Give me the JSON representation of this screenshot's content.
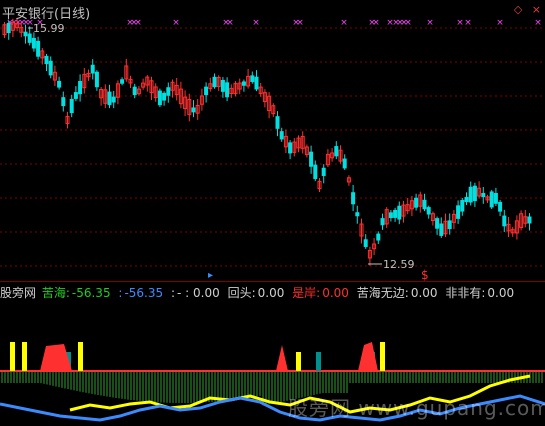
{
  "title": "平安银行(日线)",
  "price_labels": {
    "high": "15.99",
    "low": "12.59"
  },
  "signal_marker": "$",
  "indicator": {
    "name": "股旁网",
    "items": [
      {
        "label": "苦海:",
        "value": "-56.35",
        "color": "#22cc22"
      },
      {
        "label": ":",
        "value": "-56.35",
        "color": "#3b8bff"
      },
      {
        "label": ":",
        "value": "- : 0.00",
        "color": "#d0d0d0"
      },
      {
        "label": "回头:",
        "value": "0.00",
        "color": "#d0d0d0"
      },
      {
        "label": "是岸:",
        "value": "0.00",
        "color": "#ff3030"
      },
      {
        "label": "苦海无边:",
        "value": "0.00",
        "color": "#d0d0d0"
      },
      {
        "label": "非非有:",
        "value": "0.00",
        "color": "#d0d0d0"
      }
    ]
  },
  "window_controls": [
    "◇",
    "×"
  ],
  "watermark": "股旁网 www.gupang.com",
  "colors": {
    "up": "#ff3030",
    "down": "#00e0e0",
    "grid": "#800000",
    "magenta": "#ff40ff",
    "yellow": "#ffff00",
    "blue": "#3b8bff",
    "teal": "#009090"
  }
}
